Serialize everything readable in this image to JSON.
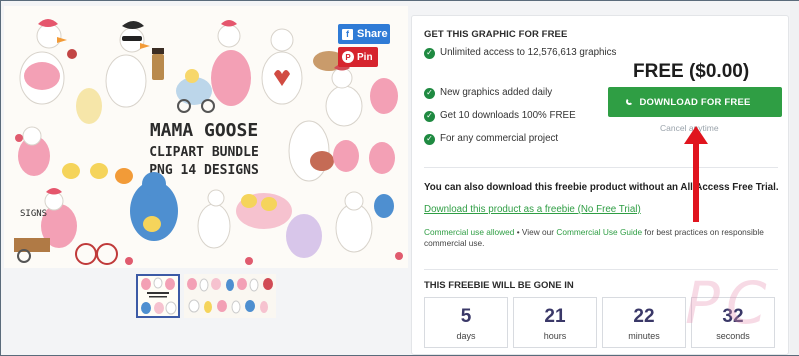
{
  "share": {
    "label": "Share",
    "pin_label": "Pin"
  },
  "product_image": {
    "title": "MAMA GOOSE",
    "subtitle_line1": "CLIPART BUNDLE",
    "subtitle_line2": "PNG 14 DESIGNS",
    "corner_mark": "SIGNS"
  },
  "offer": {
    "title": "GET THIS GRAPHIC FOR FREE",
    "features": [
      "Unlimited access to 12,576,613 graphics",
      "New graphics added daily",
      "Get 10 downloads 100% FREE",
      "For any commercial project"
    ],
    "price": "FREE ($0.00)",
    "download_label": "DOWNLOAD FOR FREE",
    "cancel_text": "Cancel anytime"
  },
  "alternative": {
    "text": "You can also download this freebie product without an All Access Free Trial.",
    "link": "Download this product as a freebie (No Free Trial)",
    "usage_prefix": "Commercial use allowed",
    "usage_mid": " • View our ",
    "usage_link": "Commercial Use Guide",
    "usage_suffix": " for best practices on responsible commercial use."
  },
  "countdown": {
    "title": "THIS FREEBIE WILL BE GONE IN",
    "items": [
      {
        "value": "5",
        "unit": "days"
      },
      {
        "value": "21",
        "unit": "hours"
      },
      {
        "value": "22",
        "unit": "minutes"
      },
      {
        "value": "32",
        "unit": "seconds"
      }
    ]
  },
  "colors": {
    "accent_green": "#2f9e44",
    "facebook_blue": "#2f7bd6",
    "pinterest_red": "#d6242e",
    "arrow_red": "#e0141e",
    "countdown_text": "#3a3868"
  },
  "icons": [
    "facebook-icon",
    "pinterest-icon",
    "check-circle-icon",
    "spinner-icon",
    "arrow-up-icon"
  ]
}
